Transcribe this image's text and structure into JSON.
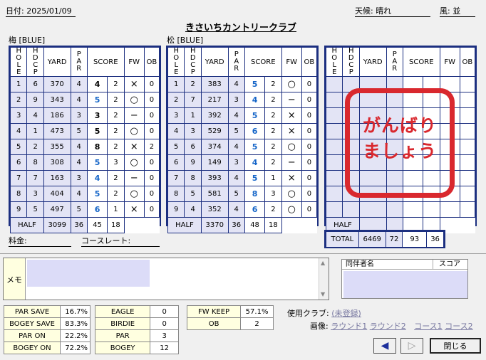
{
  "header": {
    "date": "日付: 2025/01/09",
    "weather": "天候: 晴れ",
    "wind": "風: 並",
    "club_name": "きさいちカントリークラブ"
  },
  "colheads": {
    "hole": "HOLE",
    "hdcp": "HDCP",
    "yard": "YARD",
    "par": "PAR",
    "score": "SCORE",
    "fw": "FW",
    "ob": "OB"
  },
  "out": {
    "label": "梅 [BLUE]",
    "rows": [
      {
        "hole": "1",
        "hdcp": "6",
        "yard": "370",
        "par": "4",
        "score": "4",
        "putts": "2",
        "fw": "×",
        "ob": "0"
      },
      {
        "hole": "2",
        "hdcp": "9",
        "yard": "343",
        "par": "4",
        "score": "5",
        "putts": "2",
        "fw": "○",
        "ob": "0"
      },
      {
        "hole": "3",
        "hdcp": "4",
        "yard": "186",
        "par": "3",
        "score": "3",
        "putts": "2",
        "fw": "−",
        "ob": "0"
      },
      {
        "hole": "4",
        "hdcp": "1",
        "yard": "473",
        "par": "5",
        "score": "5",
        "putts": "2",
        "fw": "○",
        "ob": "0"
      },
      {
        "hole": "5",
        "hdcp": "2",
        "yard": "355",
        "par": "4",
        "score": "8",
        "putts": "2",
        "fw": "×",
        "ob": "2"
      },
      {
        "hole": "6",
        "hdcp": "8",
        "yard": "308",
        "par": "4",
        "score": "5",
        "putts": "3",
        "fw": "○",
        "ob": "0"
      },
      {
        "hole": "7",
        "hdcp": "7",
        "yard": "163",
        "par": "3",
        "score": "4",
        "putts": "2",
        "fw": "−",
        "ob": "0"
      },
      {
        "hole": "8",
        "hdcp": "3",
        "yard": "404",
        "par": "4",
        "score": "5",
        "putts": "2",
        "fw": "○",
        "ob": "0"
      },
      {
        "hole": "9",
        "hdcp": "5",
        "yard": "497",
        "par": "5",
        "score": "6",
        "putts": "1",
        "fw": "×",
        "ob": "0"
      }
    ],
    "half": {
      "label": "HALF",
      "yard": "3099",
      "par": "36",
      "score": "45",
      "putts": "18"
    }
  },
  "in": {
    "label": "松 [BLUE]",
    "rows": [
      {
        "hole": "1",
        "hdcp": "2",
        "yard": "383",
        "par": "4",
        "score": "5",
        "putts": "2",
        "fw": "○",
        "ob": "0"
      },
      {
        "hole": "2",
        "hdcp": "7",
        "yard": "217",
        "par": "3",
        "score": "4",
        "putts": "2",
        "fw": "−",
        "ob": "0"
      },
      {
        "hole": "3",
        "hdcp": "1",
        "yard": "392",
        "par": "4",
        "score": "5",
        "putts": "2",
        "fw": "×",
        "ob": "0"
      },
      {
        "hole": "4",
        "hdcp": "3",
        "yard": "529",
        "par": "5",
        "score": "6",
        "putts": "2",
        "fw": "×",
        "ob": "0"
      },
      {
        "hole": "5",
        "hdcp": "6",
        "yard": "374",
        "par": "4",
        "score": "5",
        "putts": "2",
        "fw": "○",
        "ob": "0"
      },
      {
        "hole": "6",
        "hdcp": "9",
        "yard": "149",
        "par": "3",
        "score": "4",
        "putts": "2",
        "fw": "−",
        "ob": "0"
      },
      {
        "hole": "7",
        "hdcp": "8",
        "yard": "393",
        "par": "4",
        "score": "5",
        "putts": "1",
        "fw": "×",
        "ob": "0"
      },
      {
        "hole": "8",
        "hdcp": "5",
        "yard": "581",
        "par": "5",
        "score": "8",
        "putts": "3",
        "fw": "○",
        "ob": "0"
      },
      {
        "hole": "9",
        "hdcp": "4",
        "yard": "352",
        "par": "4",
        "score": "6",
        "putts": "2",
        "fw": "○",
        "ob": "0"
      }
    ],
    "half": {
      "label": "HALF",
      "yard": "3370",
      "par": "36",
      "score": "48",
      "putts": "18"
    }
  },
  "third": {
    "half_label": "HALF",
    "stamp_line1": "がんばり",
    "stamp_line2": "ましょう"
  },
  "total": {
    "label": "TOTAL",
    "yard": "6469",
    "par": "72",
    "score": "93",
    "putts": "36"
  },
  "fees": {
    "fee": "料金:",
    "rating": "コースレート:"
  },
  "memo": {
    "label": "メモ"
  },
  "companions": {
    "name_col": "同伴者名",
    "score_col": "スコア"
  },
  "stats_a": [
    {
      "label": "PAR SAVE",
      "value": "16.7%"
    },
    {
      "label": "BOGEY SAVE",
      "value": "83.3%"
    },
    {
      "label": "PAR ON",
      "value": "22.2%"
    },
    {
      "label": "BOGEY ON",
      "value": "72.2%"
    }
  ],
  "stats_b": [
    {
      "label": "EAGLE",
      "value": "0"
    },
    {
      "label": "BIRDIE",
      "value": "0"
    },
    {
      "label": "PAR",
      "value": "3"
    },
    {
      "label": "BOGEY",
      "value": "12"
    }
  ],
  "stats_c": [
    {
      "label": "FW KEEP",
      "value": "57.1%"
    },
    {
      "label": "OB",
      "value": "2"
    }
  ],
  "clubs": {
    "label": "使用クラブ:",
    "value": "(未登録)"
  },
  "images": {
    "label": "画像:",
    "round1": "ラウンド1",
    "round2": "ラウンド2",
    "course1": "コース1",
    "course2": "コース2"
  },
  "buttons": {
    "prev": "◀",
    "next": "▷",
    "close": "閉じる"
  },
  "colors": {
    "grid": "#1c2f80",
    "score_blue": "#1465c8",
    "stamp_red": "#d9282e",
    "row_lavender": "#e3e4f5"
  }
}
